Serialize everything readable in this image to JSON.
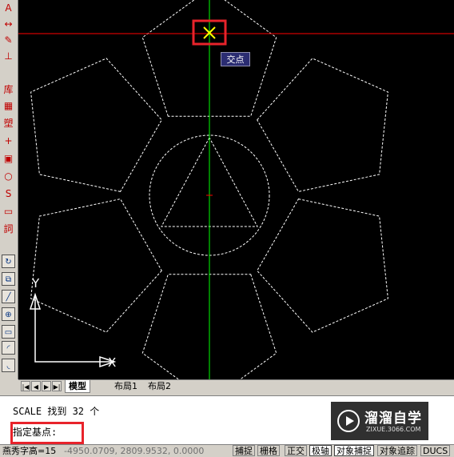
{
  "canvas": {
    "tooltip": "交点",
    "ucs_x": "X",
    "ucs_y": "Y",
    "colors": {
      "background": "#000000",
      "crosshair_h": "#ff0000",
      "crosshair_v": "#00ff00",
      "geometry": "#ffffff",
      "snap_marker": "#ffff00",
      "highlight": "#e8232b"
    }
  },
  "toolbar": {
    "items": [
      {
        "icon": "text-style-icon",
        "glyph": "A"
      },
      {
        "icon": "dimension-icon",
        "glyph": "↔"
      },
      {
        "icon": "fill-icon",
        "glyph": "✎"
      },
      {
        "icon": "measure-icon",
        "glyph": "⊥"
      },
      {
        "icon": "library-icon",
        "glyph": "库"
      },
      {
        "icon": "table-icon",
        "glyph": "▦"
      },
      {
        "icon": "plastic-icon",
        "glyph": "塑"
      },
      {
        "icon": "cross-icon",
        "glyph": "+"
      },
      {
        "icon": "layers-icon",
        "glyph": "▣"
      },
      {
        "icon": "circle-icon",
        "glyph": "○"
      },
      {
        "icon": "spline-icon",
        "glyph": "S"
      },
      {
        "icon": "monitor-icon",
        "glyph": "▭"
      },
      {
        "icon": "word-icon",
        "glyph": "詞"
      },
      {
        "icon": "rotate-icon",
        "glyph": "↻"
      },
      {
        "icon": "copy-icon",
        "glyph": "⧉"
      },
      {
        "icon": "pen-icon",
        "glyph": "╱"
      },
      {
        "icon": "stamp-icon",
        "glyph": "⊕"
      },
      {
        "icon": "rect-icon",
        "glyph": "▭"
      },
      {
        "icon": "arc-icon",
        "glyph": "◜"
      },
      {
        "icon": "fillet-icon",
        "glyph": "◟"
      }
    ]
  },
  "tabs": {
    "nav": [
      "|◀",
      "◀",
      "▶",
      "▶|"
    ],
    "items": [
      {
        "label": "模型",
        "active": true
      },
      {
        "label": "布局1",
        "active": false
      },
      {
        "label": "布局2",
        "active": false
      }
    ]
  },
  "command": {
    "line1": "SCALE 找到 32 个",
    "line2": "指定基点:"
  },
  "watermark": {
    "name": "溜溜自学",
    "url": "ZIXUE.3066.COM"
  },
  "status": {
    "font_label": "燕秀字高=15",
    "coords": "-4950.0709, 2809.9532, 0.0000",
    "buttons": [
      "捕捉",
      "栅格",
      "正交",
      "极轴",
      "对象捕捉",
      "对象追踪",
      "DUCS"
    ]
  }
}
